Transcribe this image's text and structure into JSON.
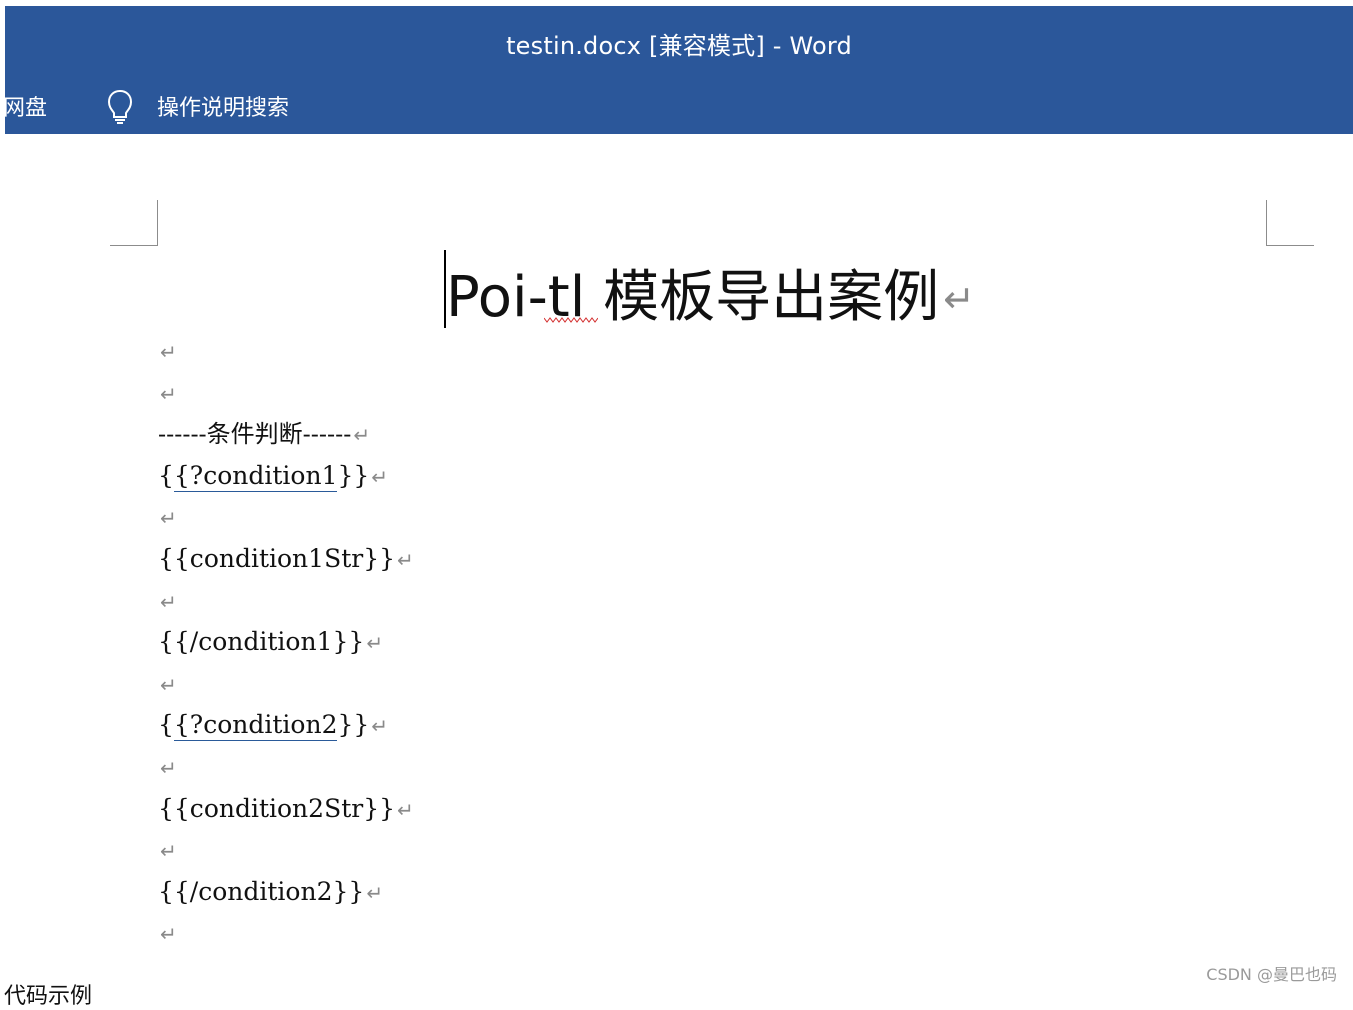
{
  "window": {
    "title": "testin.docx [兼容模式]  -  Word"
  },
  "ribbon": {
    "netdisk_label": "网盘",
    "tell_me_label": "操作说明搜索",
    "tell_me_icon": "lightbulb-icon"
  },
  "document": {
    "title": "Poi-tl 模板导出案例",
    "paragraph_mark": "↵",
    "lines": [
      "",
      "",
      "------条件判断------",
      "{{?condition1}}",
      "",
      "{{condition1Str}}",
      "",
      "{{/condition1}}",
      "",
      "{{?condition2}}",
      "",
      "{{condition2Str}}",
      "",
      "{{/condition2}}",
      ""
    ],
    "underline_color": "#2a5a99",
    "spellcheck_color": "#d32f2f"
  },
  "below_document": {
    "partial_text": "代码示例"
  },
  "watermark": "CSDN @曼巴也码",
  "colors": {
    "titlebar": "#2b579a",
    "titlebar_text": "#ffffff",
    "paragraph_mark": "#8a8a8a"
  }
}
